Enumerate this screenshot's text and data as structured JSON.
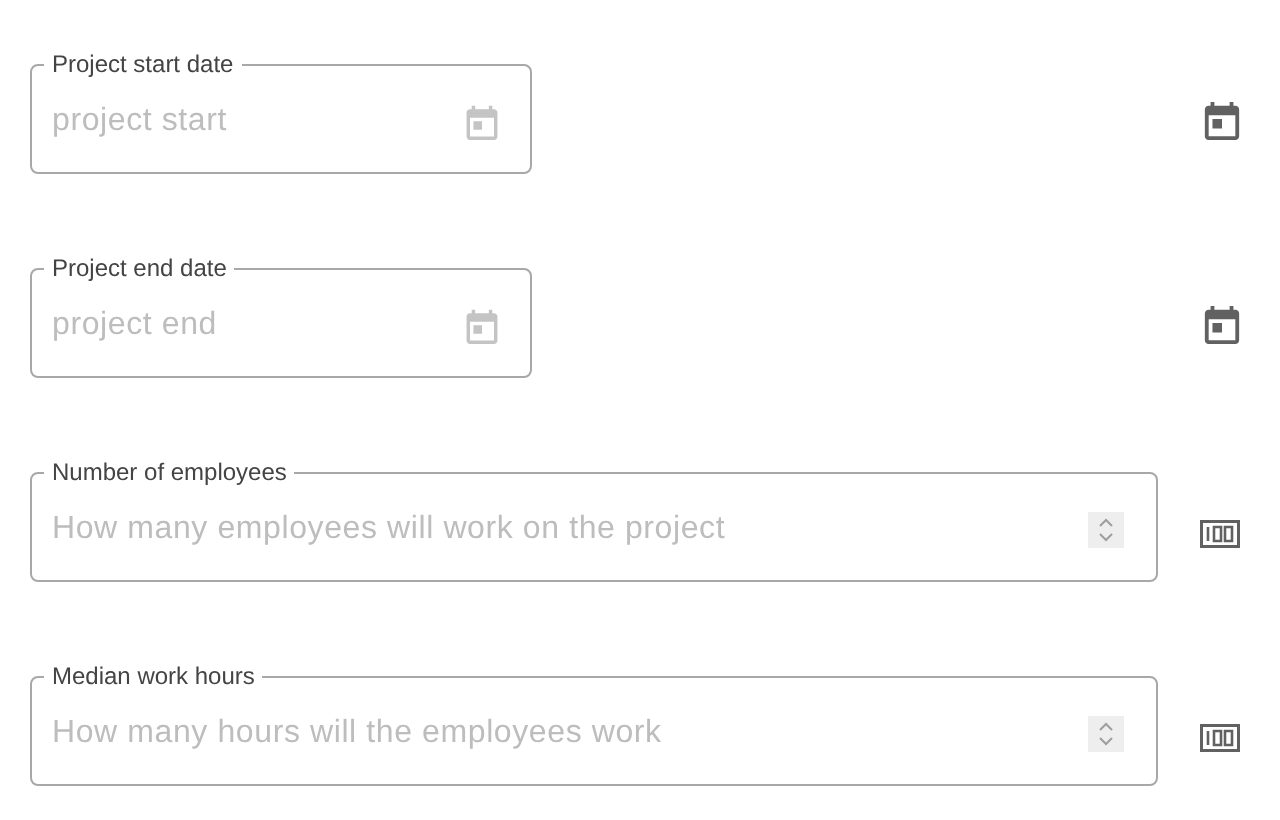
{
  "fields": [
    {
      "kind": "date",
      "label": "Project start date",
      "placeholder": "project start"
    },
    {
      "kind": "date",
      "label": "Project end date",
      "placeholder": "project end"
    },
    {
      "kind": "number",
      "label": "Number of employees",
      "placeholder": "How many employees will work on the project"
    },
    {
      "kind": "number",
      "label": "Median work hours",
      "placeholder": "How many hours will the employees work"
    }
  ]
}
